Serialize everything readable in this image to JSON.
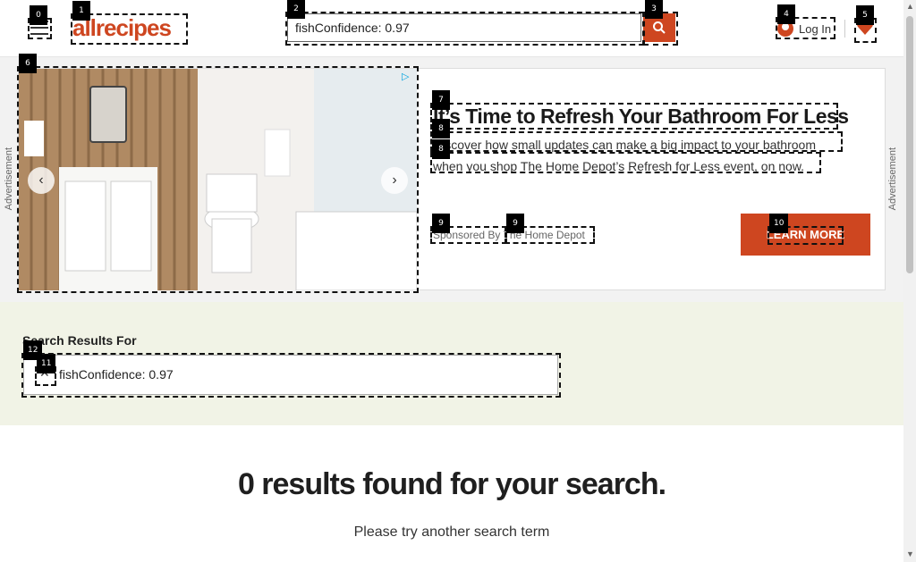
{
  "header": {
    "logo_text": "allrecipes",
    "search_value": "fishConfidence: 0.97",
    "login_label": "Log In",
    "brand_color": "#ce4620"
  },
  "ad": {
    "side_label": "Advertisement",
    "title": "It’s Time to Refresh Your Bathroom For Less",
    "desc_line1": "Discover how small updates can make a big impact to your bathroom",
    "desc_line2": "when you shop The Home Depot’s Refresh for Less event, on now.",
    "sponsored_by": "Sponsored By",
    "sponsor_name": "The Home Depot",
    "cta_label": "LEARN MORE"
  },
  "results": {
    "heading": "Search Results For",
    "query": "fishConfidence: 0.97",
    "empty_title": "0 results found for your search.",
    "empty_sub": "Please try another search term"
  },
  "markers": [
    "0",
    "1",
    "2",
    "3",
    "4",
    "5",
    "6",
    "7",
    "8",
    "8",
    "9",
    "9",
    "10",
    "11",
    "12"
  ]
}
